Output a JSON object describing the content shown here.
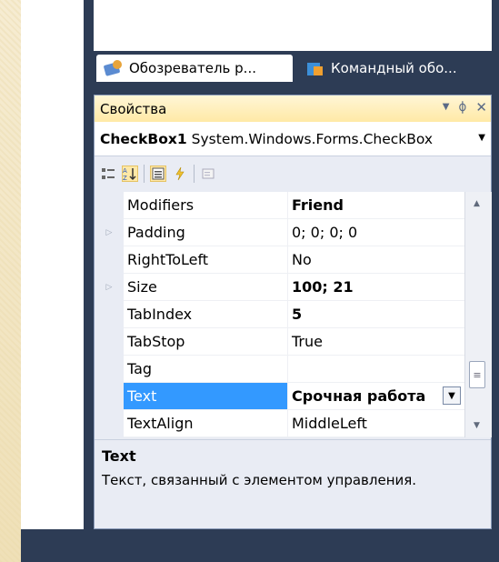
{
  "tabs": [
    {
      "label": "Обозреватель р...",
      "icon": "solution-explorer-icon"
    },
    {
      "label": "Командный обо...",
      "icon": "team-explorer-icon"
    }
  ],
  "properties": {
    "title": "Свойства",
    "title_buttons": [
      "▼",
      "ᛰ",
      "✕"
    ],
    "object_name": "CheckBox1",
    "object_type": "System.Windows.Forms.CheckBox",
    "rows": [
      {
        "name": "Modifiers",
        "value": "Friend",
        "bold": true,
        "expandable": false
      },
      {
        "name": "Padding",
        "value": "0; 0; 0; 0",
        "bold": false,
        "expandable": true
      },
      {
        "name": "RightToLeft",
        "value": "No",
        "bold": false,
        "expandable": false
      },
      {
        "name": "Size",
        "value": "100; 21",
        "bold": true,
        "expandable": true
      },
      {
        "name": "TabIndex",
        "value": "5",
        "bold": true,
        "expandable": false
      },
      {
        "name": "TabStop",
        "value": "True",
        "bold": false,
        "expandable": false
      },
      {
        "name": "Tag",
        "value": "",
        "bold": false,
        "expandable": false
      },
      {
        "name": "Text",
        "value": "Срочная работа",
        "bold": true,
        "expandable": false,
        "selected": true
      },
      {
        "name": "TextAlign",
        "value": "MiddleLeft",
        "bold": false,
        "expandable": false
      }
    ],
    "description_title": "Text",
    "description_text": "Текст, связанный с элементом управления."
  },
  "colors": {
    "frame": "#2d3c55",
    "selection": "#3399ff",
    "title_bar": "#ffe9a6"
  }
}
